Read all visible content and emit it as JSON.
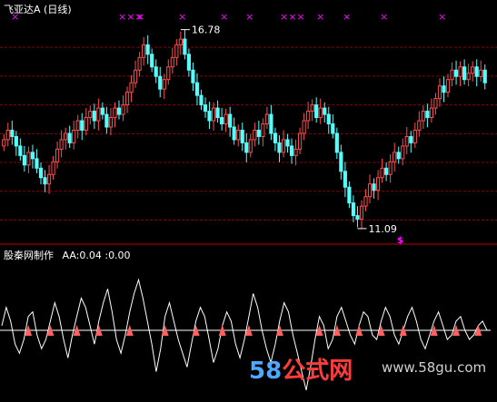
{
  "upper_panel": {
    "title": "飞亚达A",
    "period": "(日线)",
    "high_label": "16.78",
    "low_label": "11.09",
    "signal_mark": "$",
    "cross_marks": [
      "×",
      "×××",
      "×",
      "×",
      "×",
      "×",
      "×××",
      "×",
      "×",
      "×",
      "×"
    ]
  },
  "lower_panel": {
    "indicator_name": "股秦网制作",
    "readout": "AA:0.04 :0.00"
  },
  "watermark": {
    "prefix": "58",
    "middle": "公式网",
    "url": "www.58gu.com"
  },
  "colors": {
    "up": "#ff4d4d",
    "down": "#54ffff",
    "grid": "#8a0000",
    "marker": "#ff00ff",
    "line": "#ffffff",
    "arrow": "#ff6060",
    "watermark": "#4da8ff"
  },
  "chart_data": [
    {
      "type": "candlestick",
      "title": "飞亚达A (日线)",
      "ylim": [
        10.5,
        17.5
      ],
      "annotations": [
        {
          "text": "16.78",
          "kind": "high"
        },
        {
          "text": "11.09",
          "kind": "low"
        }
      ],
      "close_series": [
        13.6,
        13.9,
        13.7,
        13.4,
        13.1,
        12.8,
        13.2,
        13.0,
        12.7,
        12.4,
        12.2,
        12.5,
        12.9,
        13.3,
        13.6,
        13.8,
        13.5,
        13.9,
        14.2,
        13.9,
        14.3,
        14.5,
        14.2,
        14.6,
        14.4,
        14.0,
        14.3,
        14.6,
        14.4,
        14.7,
        15.1,
        15.4,
        15.8,
        16.2,
        16.6,
        16.3,
        15.9,
        15.6,
        15.2,
        15.5,
        15.9,
        16.2,
        16.6,
        16.78,
        16.3,
        15.8,
        15.4,
        15.0,
        14.7,
        14.5,
        14.2,
        14.6,
        14.3,
        14.1,
        14.4,
        14.0,
        13.6,
        13.9,
        13.5,
        13.2,
        13.6,
        13.9,
        13.7,
        14.1,
        14.4,
        13.8,
        13.5,
        13.2,
        13.6,
        13.4,
        13.1,
        13.3,
        13.8,
        14.2,
        14.5,
        14.7,
        14.3,
        14.6,
        14.4,
        14.1,
        13.8,
        13.2,
        12.6,
        12.1,
        11.6,
        11.2,
        11.09,
        11.5,
        11.8,
        12.2,
        12.0,
        12.4,
        12.7,
        12.5,
        12.9,
        13.2,
        13.0,
        13.4,
        13.7,
        13.5,
        13.9,
        14.2,
        14.5,
        14.3,
        14.6,
        14.9,
        15.3,
        15.1,
        15.5,
        15.8,
        15.6,
        15.9,
        15.5,
        15.7,
        15.9,
        15.6,
        15.8,
        15.4
      ]
    },
    {
      "type": "line",
      "title": "股秦网制作",
      "series": [
        {
          "name": "AA",
          "values": [
            0.1,
            0.5,
            0.2,
            -0.3,
            -0.5,
            -0.2,
            0.3,
            0.4,
            -0.1,
            -0.4,
            -0.2,
            0.2,
            0.6,
            0.3,
            -0.2,
            -0.6,
            -0.1,
            0.3,
            0.7,
            0.5,
            0.1,
            -0.3,
            0.2,
            0.6,
            0.9,
            0.4,
            -0.2,
            -0.5,
            -0.1,
            0.4,
            0.8,
            1.1,
            0.7,
            0.2,
            -0.3,
            -0.9,
            -0.4,
            0.3,
            0.6,
            0.2,
            -0.2,
            -0.5,
            -0.8,
            -0.3,
            0.2,
            0.5,
            0.3,
            -0.2,
            -0.7,
            -0.4,
            0.1,
            0.4,
            0.2,
            -0.3,
            -0.6,
            -0.2,
            0.3,
            0.8,
            0.5,
            0.0,
            -0.4,
            -0.7,
            -0.3,
            0.2,
            0.6,
            0.4,
            -0.1,
            -0.5,
            -0.9,
            -1.3,
            -0.8,
            -0.2,
            0.3,
            0.1,
            -0.4,
            -0.2,
            0.3,
            0.5,
            0.2,
            -0.1,
            -0.3,
            0.1,
            0.4,
            0.3,
            -0.1,
            -0.2,
            0.2,
            0.5,
            0.3,
            -0.1,
            -0.3,
            0.0,
            0.3,
            0.5,
            0.2,
            -0.2,
            -0.4,
            -0.1,
            0.2,
            0.4,
            0.1,
            -0.2,
            -0.1,
            0.2,
            0.3,
            0.0,
            -0.2,
            -0.1,
            0.1,
            0.2,
            0.0
          ]
        },
        {
          "name": "zero",
          "values": [
            0
          ]
        }
      ],
      "ylim": [
        -1.5,
        1.5
      ],
      "readout": {
        "AA": 0.04,
        "zero": 0.0
      }
    }
  ]
}
